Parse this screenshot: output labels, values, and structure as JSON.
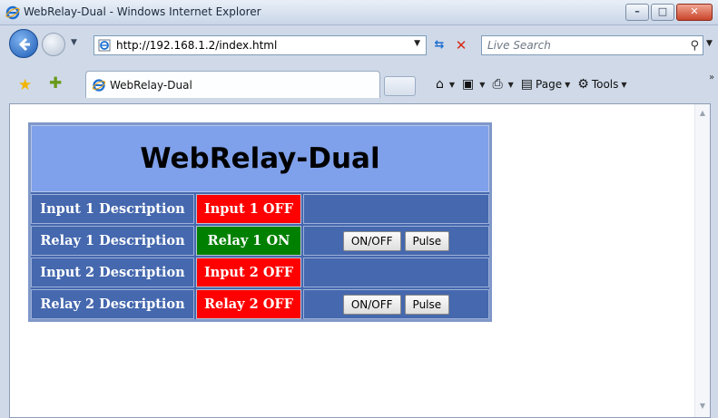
{
  "window": {
    "title": "WebRelay-Dual - Windows Internet Explorer"
  },
  "address_bar": {
    "url": "http://192.168.1.2/index.html"
  },
  "search": {
    "placeholder": "Live Search"
  },
  "tab": {
    "label": "WebRelay-Dual"
  },
  "command_bar": {
    "page_label": "Page",
    "tools_label": "Tools"
  },
  "page": {
    "heading": "WebRelay-Dual",
    "rows": [
      {
        "description": "Input 1 Description",
        "status": "Input 1 OFF",
        "state": "off",
        "has_controls": false
      },
      {
        "description": "Relay 1 Description",
        "status": "Relay 1 ON",
        "state": "on",
        "has_controls": true
      },
      {
        "description": "Input 2 Description",
        "status": "Input 2 OFF",
        "state": "off",
        "has_controls": false
      },
      {
        "description": "Relay 2 Description",
        "status": "Relay 2 OFF",
        "state": "off",
        "has_controls": true
      }
    ],
    "buttons": {
      "toggle_label": "ON/OFF",
      "pulse_label": "Pulse"
    }
  },
  "colors": {
    "status_off": "#fe0000",
    "status_on": "#008000",
    "table_bg": "#4568ae",
    "heading_bg": "#7fa0ea"
  }
}
